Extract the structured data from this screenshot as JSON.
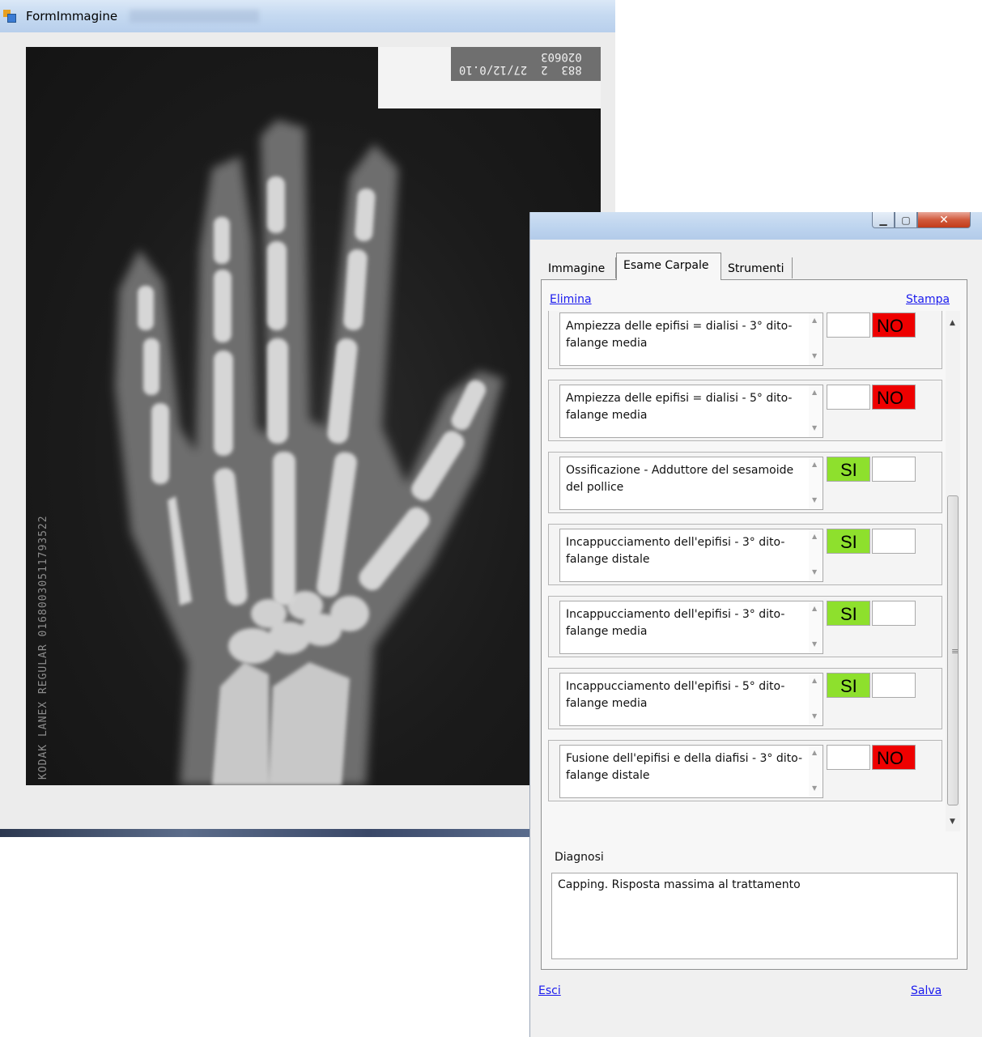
{
  "back_window": {
    "title": "FormImmagine",
    "xray_label_text": "883  2  27/12/0.10\n020603",
    "film_text": "KODAK LANEX REGULAR  01680030511793522"
  },
  "front_window": {
    "tabs": [
      "Immagine",
      "Esame Carpale",
      "Strumenti"
    ],
    "active_tab": "Esame Carpale",
    "elimina_label": "Elimina",
    "stampa_label": "Stampa",
    "criteria": [
      {
        "text": "Ampiezza delle epifisi = dialisi - 3° dito-falange media",
        "answer": "NO"
      },
      {
        "text": "Ampiezza delle epifisi = dialisi - 5° dito-falange media",
        "answer": "NO"
      },
      {
        "text": "Ossificazione - Adduttore del sesamoide del pollice",
        "answer": "SI"
      },
      {
        "text": "Incappucciamento dell'epifisi - 3° dito-falange distale",
        "answer": "SI"
      },
      {
        "text": "Incappucciamento dell'epifisi - 3° dito-falange media",
        "answer": "SI"
      },
      {
        "text": "Incappucciamento dell'epifisi - 5° dito-falange media",
        "answer": "SI"
      },
      {
        "text": "Fusione dell'epifisi e della diafisi - 3° dito-falange distale",
        "answer": "NO"
      }
    ],
    "diagnosi_label": "Diagnosi",
    "diagnosi_value": "Capping. Risposta massima al trattamento",
    "esci_label": "Esci",
    "salva_label": "Salva",
    "colors": {
      "si": "#8ee02d",
      "no": "#ee0000"
    }
  },
  "icons": [
    "app-icon",
    "minimize-icon",
    "maximize-icon",
    "close-icon",
    "scroll-up-icon",
    "scroll-down-icon"
  ]
}
